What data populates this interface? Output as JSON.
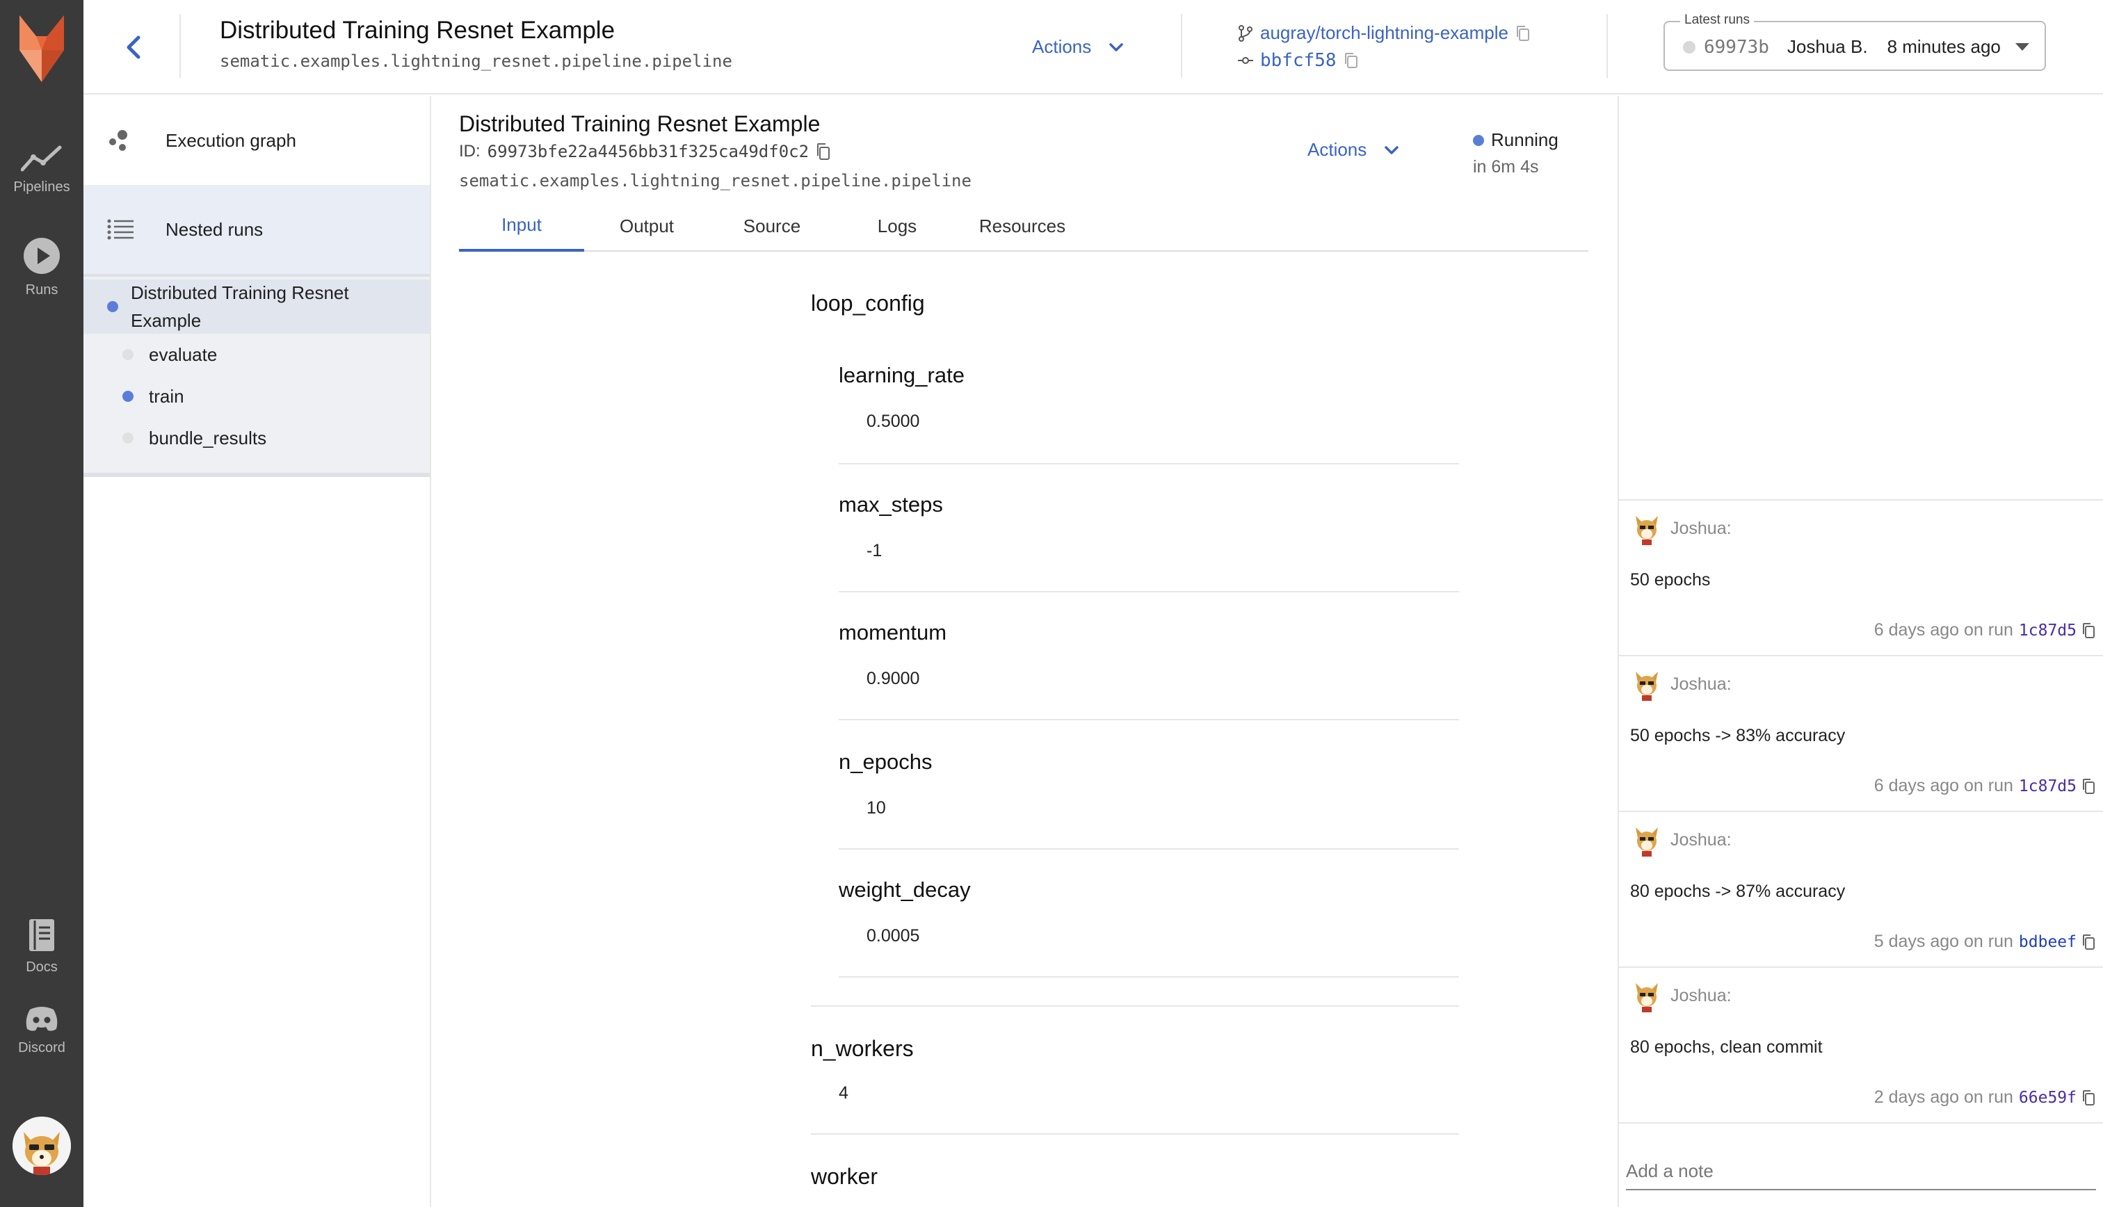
{
  "nav": {
    "items": [
      {
        "label": "Pipelines",
        "icon": "pipelines-icon"
      },
      {
        "label": "Runs",
        "icon": "runs-icon"
      },
      {
        "label": "Docs",
        "icon": "docs-icon"
      },
      {
        "label": "Discord",
        "icon": "discord-icon"
      }
    ]
  },
  "header": {
    "title": "Distributed Training Resnet Example",
    "subtitle": "sematic.examples.lightning_resnet.pipeline.pipeline",
    "actions_label": "Actions",
    "repo": "augray/torch-lightning-example",
    "commit": "bbfcf58",
    "latest_runs": {
      "label": "Latest runs",
      "run_id": "69973b",
      "user": "Joshua B.",
      "time": "8 minutes ago"
    }
  },
  "sidepanel": {
    "tabs": [
      {
        "label": "Execution graph"
      },
      {
        "label": "Nested runs"
      }
    ],
    "tree": {
      "root": "Distributed Training Resnet",
      "root_line2": "Example",
      "children": [
        "evaluate",
        "train",
        "bundle_results"
      ]
    }
  },
  "run": {
    "title": "Distributed Training Resnet Example",
    "id_label": "ID:",
    "id": "69973bfe22a4456bb31f325ca49df0c2",
    "function": "sematic.examples.lightning_resnet.pipeline.pipeline",
    "actions_label": "Actions",
    "status": "Running",
    "status_sub": "in 6m 4s",
    "tabs": [
      "Input",
      "Output",
      "Source",
      "Logs",
      "Resources"
    ]
  },
  "inputs": {
    "loop_config": {
      "title": "loop_config",
      "params": [
        {
          "name": "learning_rate",
          "value": "0.5000"
        },
        {
          "name": "max_steps",
          "value": "-1"
        },
        {
          "name": "momentum",
          "value": "0.9000"
        },
        {
          "name": "n_epochs",
          "value": "10"
        },
        {
          "name": "weight_decay",
          "value": "0.0005"
        }
      ]
    },
    "n_workers": {
      "title": "n_workers",
      "value": "4"
    },
    "worker": {
      "title": "worker"
    }
  },
  "notes": {
    "items": [
      {
        "author": "Joshua:",
        "body": "50 epochs",
        "meta": "6 days ago on run",
        "run": "1c87d5"
      },
      {
        "author": "Joshua:",
        "body": "50 epochs -> 83% accuracy",
        "meta": "6 days ago on run",
        "run": "1c87d5"
      },
      {
        "author": "Joshua:",
        "body": "80 epochs -> 87% accuracy",
        "meta": "5 days ago on run",
        "run": "bdbeef"
      },
      {
        "author": "Joshua:",
        "body": "80 epochs, clean commit",
        "meta": "2 days ago on run",
        "run": "66e59f"
      }
    ],
    "placeholder": "Add a note"
  },
  "colors": {
    "accent": "#3a63c4",
    "running": "#5a7ed8",
    "nav_bg": "#3a3a3a"
  }
}
